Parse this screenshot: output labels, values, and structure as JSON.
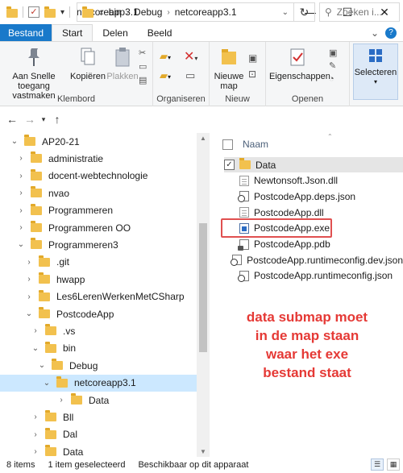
{
  "window": {
    "title": "netcoreapp3.1",
    "minimize": "—",
    "maximize": "☐",
    "close": "✕"
  },
  "ribbon_tabs": [
    "Bestand",
    "Start",
    "Delen",
    "Beeld"
  ],
  "ribbon": {
    "pin_label": "Aan Snelle toegang vastmaken",
    "copy_label": "Kopiëren",
    "paste_label": "Plakken",
    "clipboard_group": "Klembord",
    "organize_group": "Organiseren",
    "new_folder_label": "Nieuwe map",
    "new_group": "Nieuw",
    "properties_label": "Eigenschappen",
    "open_group": "Openen",
    "select_label": "Selecteren"
  },
  "address": {
    "crumbs": [
      "bin",
      "Debug",
      "netcoreapp3.1"
    ],
    "prefix": "«",
    "search_placeholder": "Zoeken i..."
  },
  "tree": [
    {
      "label": "AP20-21",
      "level": 1,
      "state": "expanded"
    },
    {
      "label": "administratie",
      "level": 2,
      "state": "collapsed"
    },
    {
      "label": "docent-webtechnologie",
      "level": 2,
      "state": "collapsed"
    },
    {
      "label": "nvao",
      "level": 2,
      "state": "collapsed"
    },
    {
      "label": "Programmeren",
      "level": 2,
      "state": "collapsed"
    },
    {
      "label": "Programmeren OO",
      "level": 2,
      "state": "collapsed"
    },
    {
      "label": "Programmeren3",
      "level": 2,
      "state": "expanded"
    },
    {
      "label": ".git",
      "level": 3,
      "state": "collapsed"
    },
    {
      "label": "hwapp",
      "level": 3,
      "state": "collapsed"
    },
    {
      "label": "Les6LerenWerkenMetCSharp",
      "level": 3,
      "state": "collapsed"
    },
    {
      "label": "PostcodeApp",
      "level": 3,
      "state": "expanded"
    },
    {
      "label": ".vs",
      "level": 4,
      "state": "collapsed"
    },
    {
      "label": "bin",
      "level": 4,
      "state": "expanded"
    },
    {
      "label": "Debug",
      "level": 5,
      "state": "expanded"
    },
    {
      "label": "netcoreapp3.1",
      "level": 6,
      "state": "expanded",
      "selected": true
    },
    {
      "label": "Data",
      "level": 7,
      "state": "collapsed"
    },
    {
      "label": "Bll",
      "level": 4,
      "state": "collapsed"
    },
    {
      "label": "Dal",
      "level": 4,
      "state": "collapsed"
    },
    {
      "label": "Data",
      "level": 4,
      "state": "collapsed"
    }
  ],
  "list": {
    "column_name": "Naam",
    "files": [
      {
        "name": "Data",
        "icon": "folder-icon",
        "checked": true
      },
      {
        "name": "Newtonsoft.Json.dll",
        "icon": "dll-file-icon"
      },
      {
        "name": "PostcodeApp.deps.json",
        "icon": "json-file-icon"
      },
      {
        "name": "PostcodeApp.dll",
        "icon": "dll-file-icon"
      },
      {
        "name": "PostcodeApp.exe",
        "icon": "exe-file-icon"
      },
      {
        "name": "PostcodeApp.pdb",
        "icon": "pdb-file-icon"
      },
      {
        "name": "PostcodeApp.runtimeconfig.dev.json",
        "icon": "json-file-icon"
      },
      {
        "name": "PostcodeApp.runtimeconfig.json",
        "icon": "json-file-icon"
      }
    ]
  },
  "annotation": {
    "lines": [
      "data submap moet",
      "in de map staan",
      "waar het exe",
      "bestand staat"
    ],
    "color": "#e53935"
  },
  "status": {
    "items": "8 items",
    "selected": "1 item geselecteerd",
    "availability": "Beschikbaar op dit apparaat"
  },
  "colors": {
    "file_tab": "#1979ca",
    "selection": "#cce8ff",
    "folder": "#f2c14e"
  }
}
